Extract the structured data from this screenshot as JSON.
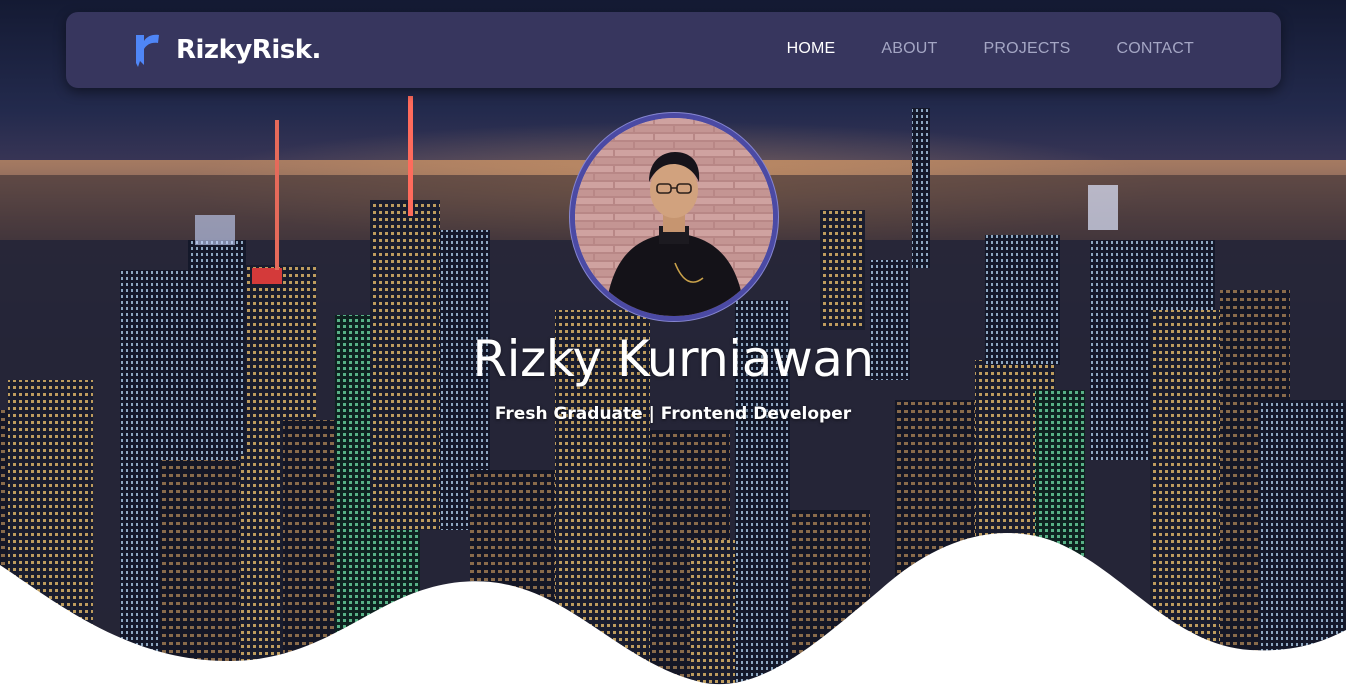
{
  "brand": {
    "name": "RizkyRisk.",
    "logo_icon": "r-logo-icon",
    "logo_color": "#4f86f7"
  },
  "nav": {
    "items": [
      {
        "label": "HOME",
        "active": true
      },
      {
        "label": "ABOUT",
        "active": false
      },
      {
        "label": "PROJECTS",
        "active": false
      },
      {
        "label": "CONTACT",
        "active": false
      }
    ],
    "background": "#37365e",
    "active_color": "#ffffff",
    "inactive_color": "#a4a6c4"
  },
  "hero": {
    "name": "Rizky Kurniawan",
    "tagline": "Fresh Graduate | Frontend Developer",
    "avatar_icon": "profile-photo",
    "avatar_border_color": "#4b4aa4",
    "background_image": "night-city-skyline"
  },
  "colors": {
    "wave": "#ffffff"
  }
}
